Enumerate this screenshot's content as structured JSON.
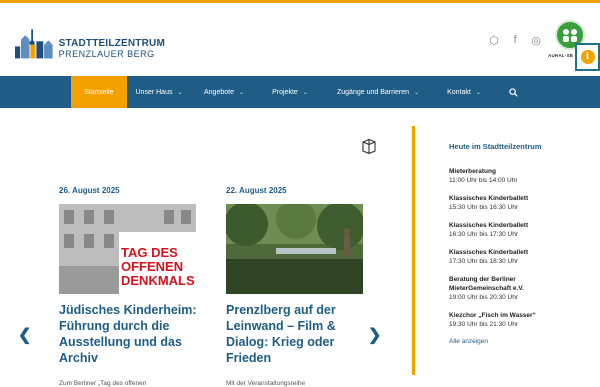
{
  "header": {
    "logo_line1": "STADTTEILZENTRUM",
    "logo_line2": "PRENZLAUER BERG",
    "social": [
      {
        "icon": "dice-icon",
        "glyph": "⬡"
      },
      {
        "icon": "facebook-icon",
        "glyph": "f"
      },
      {
        "icon": "instagram-icon",
        "glyph": "◎"
      }
    ],
    "badge_label": "AUHAL-SB",
    "a11y_glyph": "i"
  },
  "nav": {
    "items": [
      {
        "label": "Startseite",
        "active": true
      },
      {
        "label": "Unser Haus",
        "chevron": "⌄"
      },
      {
        "label": "Angebote",
        "chevron": "⌄"
      },
      {
        "label": "Projekte",
        "chevron": "⌄"
      },
      {
        "label": "Zugänge und Barrieren",
        "chevron": "⌄"
      },
      {
        "label": "Kontakt",
        "chevron": "⌄"
      }
    ],
    "search_icon": "search-icon"
  },
  "carousel": {
    "prev_glyph": "❮",
    "next_glyph": "❯",
    "cards": [
      {
        "date": "26. August 2025",
        "image_text_1": "TAG DES",
        "image_text_2": "OFFENEN",
        "image_text_3": "DENKMALS",
        "title": "Jüdisches Kinderheim: Führung durch die Ausstellung und das Archiv",
        "excerpt": "Zum Berliner „Tag des offenen"
      },
      {
        "date": "22. August 2025",
        "title": "Prenzlberg auf der Leinwand – Film & Dialog: Krieg oder Frieden",
        "excerpt": "Mit der Veranstaltungsreihe"
      }
    ]
  },
  "sidebar": {
    "title": "Heute im Stadtteilzentrum",
    "events": [
      {
        "name": "Mieterberatung",
        "time": "11:00 Uhr bis 14:00 Uhr"
      },
      {
        "name": "Klassisches Kinderballett",
        "time": "15:30 Uhr bis 16:30 Uhr"
      },
      {
        "name": "Klassisches Kinderballett",
        "time": "16:30 Uhr bis 17:30 Uhr"
      },
      {
        "name": "Klassisches Kinderballett",
        "time": "17:30 Uhr bis 18:30 Uhr"
      },
      {
        "name": "Beratung der Berliner MieterGemeinschaft e.V.",
        "time": "19:00 Uhr bis 20:30 Uhr"
      },
      {
        "name": "Kiezchor „Fisch im Wasser“",
        "time": "19:30 Uhr bis 21:30 Uhr"
      }
    ],
    "all_link": "Alle anzeigen"
  },
  "colors": {
    "brand_blue": "#1f5d86",
    "accent_orange": "#f2a100",
    "badge_green": "#3a9e3a"
  }
}
